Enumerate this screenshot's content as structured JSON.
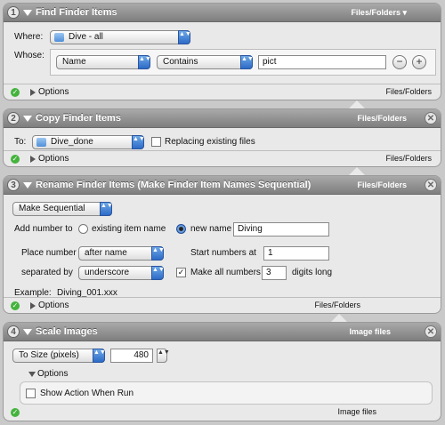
{
  "actions": [
    {
      "num": "1",
      "title": "Find Finder Items",
      "header_right": "Files/Folders",
      "where_label": "Where:",
      "where_value": "Dive - all",
      "whose_label": "Whose:",
      "attr_value": "Name",
      "op_value": "Contains",
      "text_value": "pict",
      "minus": "−",
      "plus": "+",
      "options_label": "Options",
      "footer_right": "Files/Folders"
    },
    {
      "num": "2",
      "title": "Copy Finder Items",
      "header_right": "Files/Folders",
      "to_label": "To:",
      "to_value": "Dive_done",
      "replace_label": "Replacing existing files",
      "options_label": "Options",
      "footer_right": "Files/Folders"
    },
    {
      "num": "3",
      "title": "Rename Finder Items (Make Finder Item Names Sequential)",
      "header_right": "Files/Folders",
      "mode_value": "Make Sequential",
      "add_number_label": "Add number to",
      "existing_label": "existing item name",
      "new_name_label": "new name",
      "new_name_value": "Diving",
      "place_label": "Place number",
      "place_value": "after name",
      "start_label": "Start numbers at",
      "start_value": "1",
      "sep_label": "separated by",
      "sep_value": "underscore",
      "make_all_label": "Make all numbers",
      "digits_value": "3",
      "digits_label": "digits long",
      "example_label": "Example:",
      "example_value": "Diving_001.xxx",
      "options_label": "Options",
      "footer_right": "Files/Folders"
    },
    {
      "num": "4",
      "title": "Scale Images",
      "header_right": "Image files",
      "size_mode": "To Size (pixels)",
      "size_value": "480",
      "options_label": "Options",
      "show_label": "Show Action When Run",
      "footer_right": "Image files"
    }
  ],
  "icons": {
    "close": "✕",
    "check": "✓",
    "popup_arrows": "▲▼"
  },
  "colors": {
    "titlebar": "#8e8e8e",
    "panel": "#e9e9e9",
    "accent_blue": "#2d6bc7",
    "success_green": "#44b33c"
  }
}
